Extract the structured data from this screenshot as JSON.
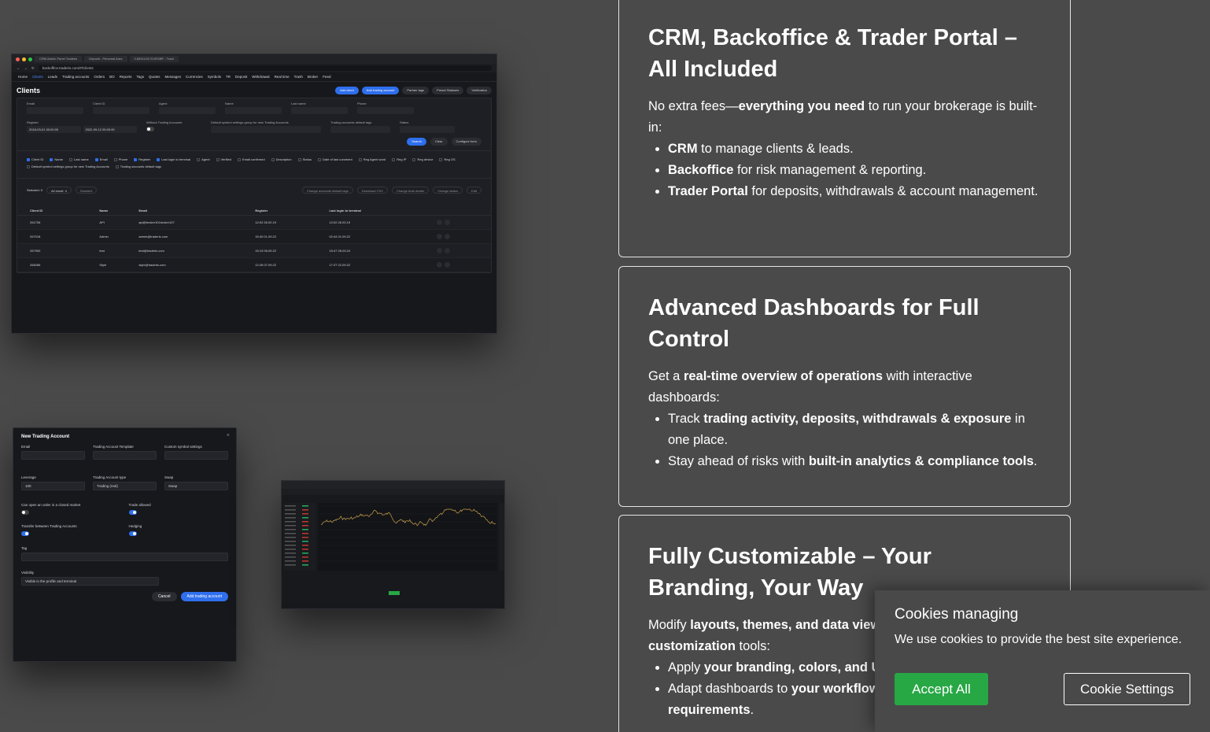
{
  "shot1": {
    "tabs": [
      "CRM Admin Panel Traderis",
      "Deposit - Personal Area",
      "0.83311/22 EURGBP - Tradi"
    ],
    "url": "backoffice.traderis.com/#/Clients",
    "menu": [
      "Home",
      "Clients",
      "Leads",
      "Trading accounts",
      "Orders",
      "BO",
      "Reports",
      "Tags",
      "Quotes",
      "Messages",
      "Currencies",
      "Symbols",
      "TR",
      "Deposit",
      "Withdrawal",
      "Real time",
      "Trash",
      "Broker",
      "Feed"
    ],
    "title": "Clients",
    "buttons": [
      "Add client",
      "Add trading account",
      "Partner tags",
      "Preset Statuses",
      "Verification"
    ],
    "filters1": [
      "Email",
      "Client ID",
      "Agent",
      "Name",
      "Last name",
      "Phone"
    ],
    "filters2": {
      "register_label": "Register",
      "register_from": "2018-03-01 00:00:00",
      "register_to": "2022-09-12 00:00:00",
      "without_label": "Without Trading Accounts",
      "symbol_label": "Default symbol settings group for new Trading Accounts",
      "tags_label": "Trading accounts default tags",
      "status_label": "Status"
    },
    "search_btn": "Search",
    "clear_btn": "Clear",
    "configure_btn": "Configure form",
    "columns_on": [
      "Client ID",
      "Name",
      "Email",
      "Register",
      "Last login to terminal"
    ],
    "columns_off": [
      "Last name",
      "Phone",
      "Agent",
      "Verified",
      "Email confirmed",
      "Description",
      "Status",
      "Date of last comment",
      "Reg Agent word",
      "Reg IP",
      "Reg device",
      "Reg OS",
      "Default symbol settings group for new Trading Accounts",
      "Trading accounts default tags"
    ],
    "selected": "Selected: 0",
    "all_result": "All result: 4",
    "deselect": "Deselect",
    "actions": [
      "Change accounts default tags",
      "Download CSV",
      "Change Auto dealer",
      "Change status",
      "Edit"
    ],
    "table_headers": [
      "Client ID",
      "Name",
      "Email",
      "Register",
      "Last login to terminal"
    ],
    "rows": [
      [
        "261706",
        "API",
        "api@broker101broker107",
        "12:02 26.02.19",
        "12:02 26.02.19"
      ],
      [
        "267018",
        "Admin",
        "admin@traderis.com",
        "15:40 01.09.22",
        "02:44 01.09.22"
      ],
      [
        "267900",
        "test",
        "test@traderis.com",
        "15:13 06.09.22",
        "15:47 28.03.24"
      ],
      [
        "268286",
        "Style",
        "style@traderis.com",
        "12:28 07.09.22",
        "17:37 22.09.22"
      ]
    ]
  },
  "shot2": {
    "title": "New Trading Account",
    "email_label": "Email",
    "template_label": "Trading Account Template",
    "custom_label": "Custom symbol settings",
    "leverage_label": "Leverage",
    "leverage_value": "100",
    "type_label": "Trading Account type",
    "type_value": "Trading (real)",
    "swap_label": "Swap",
    "swap_value": "Swap",
    "closed_market_label": "Can open an order in a closed market",
    "trade_allowed_label": "Trade allowed",
    "transfer_label": "Transfer between Trading Accounts",
    "hedging_label": "Hedging",
    "tag_label": "Tag",
    "visibility_label": "Visibility",
    "visibility_value": "Visible in the profile and terminal",
    "cancel": "Cancel",
    "submit": "Add trading account"
  },
  "cards": [
    {
      "title": "CRM, Backoffice & Trader Portal – All Included",
      "intro_pre": "No extra fees—",
      "intro_bold": "everything you need",
      "intro_post": " to run your brokerage is built-in:",
      "items": [
        {
          "bold": "CRM",
          "text": " to manage clients & leads."
        },
        {
          "bold": "Backoffice",
          "text": " for risk management & reporting."
        },
        {
          "bold": "Trader Portal",
          "text": " for deposits, withdrawals & account management."
        }
      ]
    },
    {
      "title": "Advanced Dashboards for Full Control",
      "intro_pre": "Get a ",
      "intro_bold": "real-time overview of operations",
      "intro_post": " with interactive dashboards:",
      "items": [
        {
          "pre": "Track ",
          "bold": "trading activity, deposits, withdrawals & exposure",
          "text": " in one place."
        },
        {
          "pre": "Stay ahead of risks with ",
          "bold": "built-in analytics & compliance tools",
          "text": "."
        }
      ]
    },
    {
      "title": "Fully Customizable – Your Branding, Your Way",
      "intro_pre": "Modify ",
      "intro_bold": "layouts, themes, and data view",
      "intro_bold2": "customization",
      "intro_post": " tools:",
      "items": [
        {
          "pre": "Apply ",
          "bold": "your branding, colors, and UI",
          "text": ""
        },
        {
          "pre": "Adapt dashboards to ",
          "bold": "your workflow",
          "text": ""
        },
        {
          "pre": "",
          "bold": "requirements",
          "text": "."
        }
      ]
    }
  ],
  "cookie": {
    "title": "Cookies managing",
    "message": "We use cookies to provide the best site experience.",
    "accept": "Accept All",
    "settings": "Cookie Settings",
    "accept_color": "#28a745"
  }
}
